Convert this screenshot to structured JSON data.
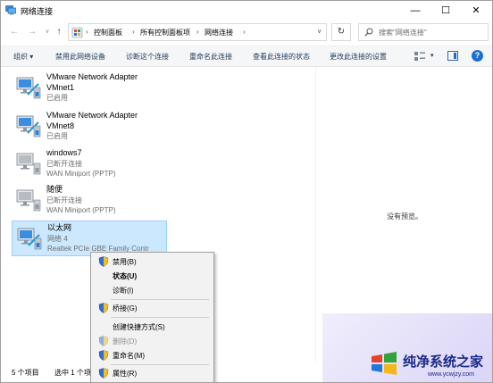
{
  "window": {
    "title": "网络连接",
    "min_glyph": "—",
    "max_glyph": "☐",
    "close_glyph": "✕"
  },
  "address": {
    "back_glyph": "←",
    "forward_glyph": "→",
    "recent_glyph": "∨",
    "up_glyph": "↑",
    "breadcrumbs": [
      "控制面板",
      "所有控制面板项",
      "网络连接"
    ],
    "separator": "›",
    "dropdown_glyph": "∨",
    "refresh_glyph": "↻",
    "search_placeholder": "搜索\"网络连接\""
  },
  "toolbar": {
    "organize": "组织 ▾",
    "disable_device": "禁用此网络设备",
    "diagnose": "诊断这个连接",
    "rename": "重命名此连接",
    "view_status": "查看此连接的状态",
    "change_settings": "更改此连接的设置",
    "view_dropdown_glyph": "▾",
    "help_glyph": "?"
  },
  "connections": [
    {
      "name": "VMware Network Adapter VMnet1",
      "name_line1": "VMware Network Adapter",
      "name_line2": "VMnet1",
      "status": "已启用",
      "device": ""
    },
    {
      "name": "VMware Network Adapter VMnet8",
      "name_line1": "VMware Network Adapter",
      "name_line2": "VMnet8",
      "status": "已启用",
      "device": ""
    },
    {
      "name": "windows7",
      "status": "已断开连接",
      "device": "WAN Miniport (PPTP)"
    },
    {
      "name": "随便",
      "status": "已断开连接",
      "device": "WAN Miniport (PPTP)"
    },
    {
      "name": "以太网",
      "status": "网络 4",
      "device": "Realtek PCIe GBE Family Contr",
      "selected": true
    }
  ],
  "preview": {
    "empty_text": "没有预览。"
  },
  "statusbar": {
    "item_count": "5 个项目",
    "selected_count": "选中 1 个项目"
  },
  "context_menu": {
    "items": [
      {
        "label": "禁用(B)",
        "shield": true,
        "bold": false,
        "disabled": false
      },
      {
        "label": "状态(U)",
        "shield": false,
        "bold": true,
        "disabled": false
      },
      {
        "label": "诊断(I)",
        "shield": false,
        "bold": false,
        "disabled": false
      },
      {
        "label": "桥接(G)",
        "shield": true,
        "bold": false,
        "disabled": false
      },
      {
        "label": "创建快捷方式(S)",
        "shield": false,
        "bold": false,
        "disabled": false
      },
      {
        "label": "删除(D)",
        "shield": true,
        "bold": false,
        "disabled": true
      },
      {
        "label": "重命名(M)",
        "shield": true,
        "bold": false,
        "disabled": false
      },
      {
        "label": "属性(R)",
        "shield": true,
        "bold": false,
        "disabled": false
      }
    ]
  },
  "watermark": {
    "title": "纯净系统之家",
    "url": "www.ycwjzy.com"
  },
  "colors": {
    "selection": "#cce8ff",
    "selection_border": "#99d1ff",
    "toolbar_text": "#1e395b",
    "accent_blue": "#1c6fd1",
    "watermark_text": "#1a2a8a"
  }
}
